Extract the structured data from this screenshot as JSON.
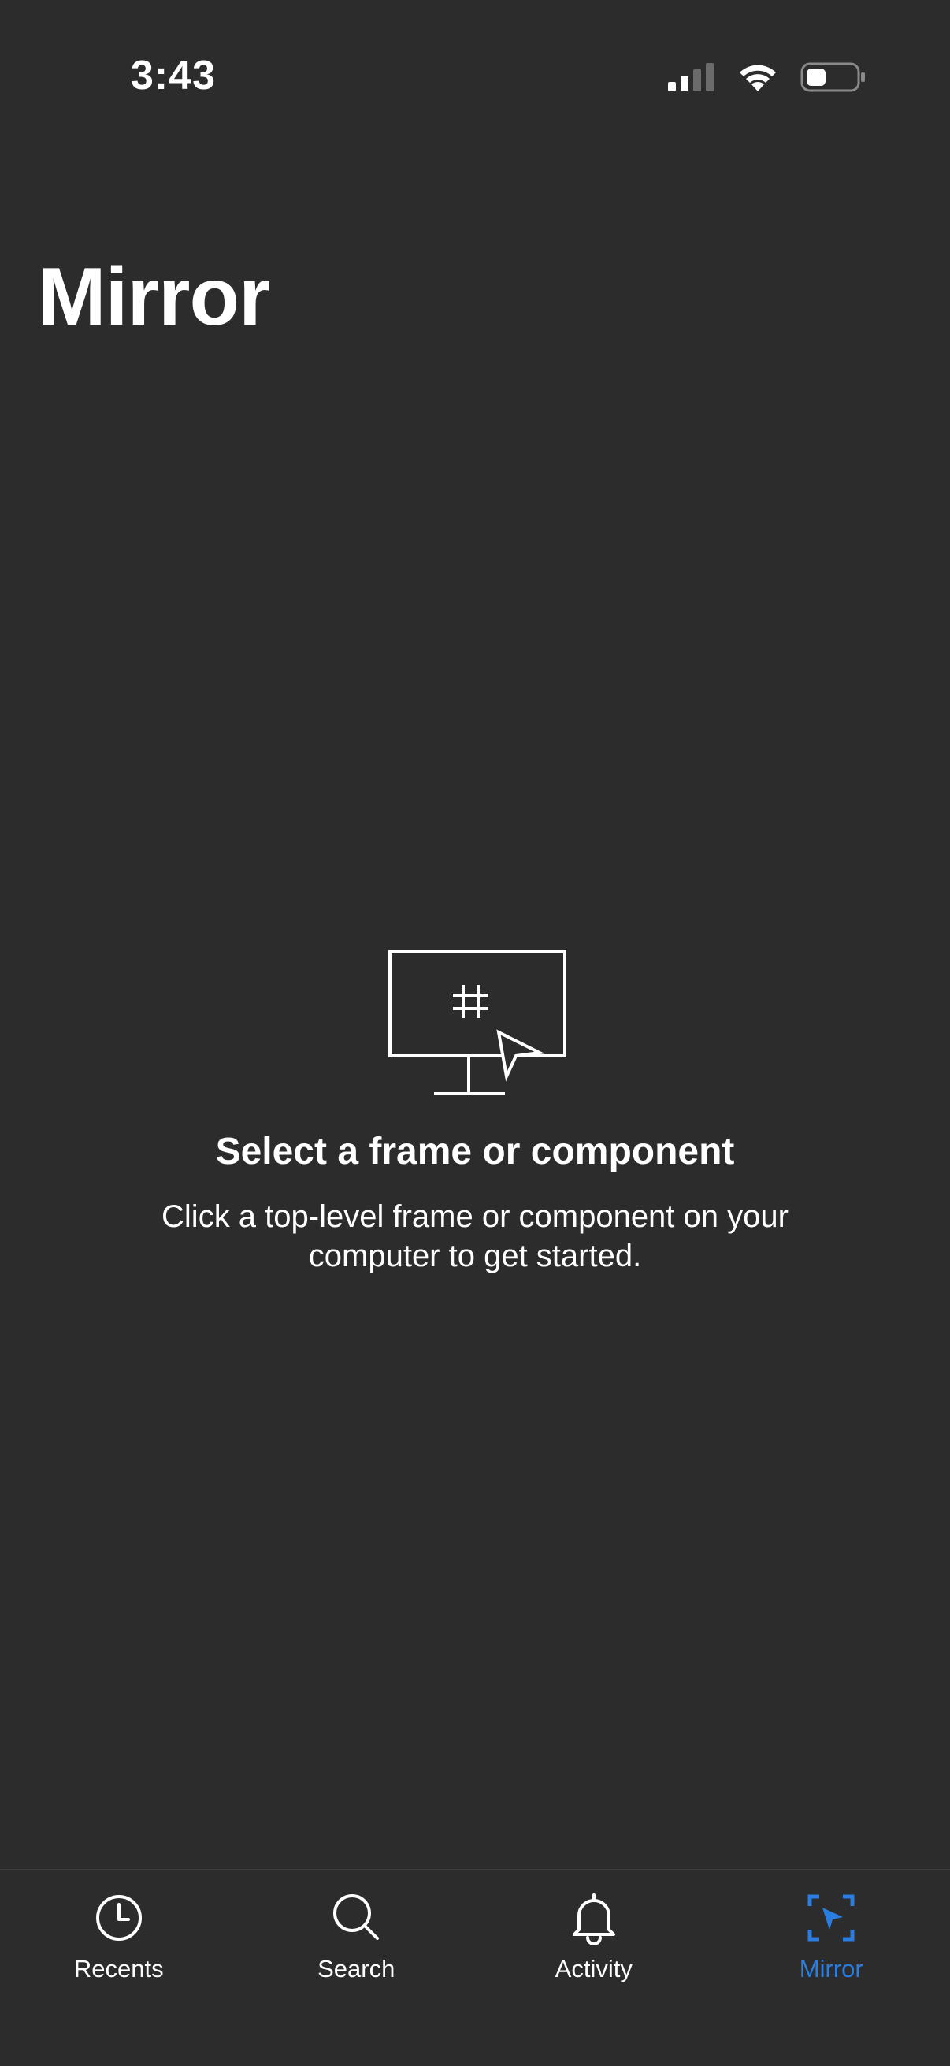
{
  "status_bar": {
    "time": "3:43"
  },
  "page": {
    "title": "Mirror"
  },
  "empty_state": {
    "title": "Select a frame or component",
    "description": "Click a top-level frame or component on your computer to get started."
  },
  "tab_bar": {
    "tabs": [
      {
        "label": "Recents",
        "icon": "clock-icon",
        "active": false
      },
      {
        "label": "Search",
        "icon": "search-icon",
        "active": false
      },
      {
        "label": "Activity",
        "icon": "bell-icon",
        "active": false
      },
      {
        "label": "Mirror",
        "icon": "mirror-cursor-icon",
        "active": true
      }
    ]
  },
  "colors": {
    "background": "#2c2c2c",
    "accent": "#2a7de1",
    "text": "#ffffff"
  }
}
